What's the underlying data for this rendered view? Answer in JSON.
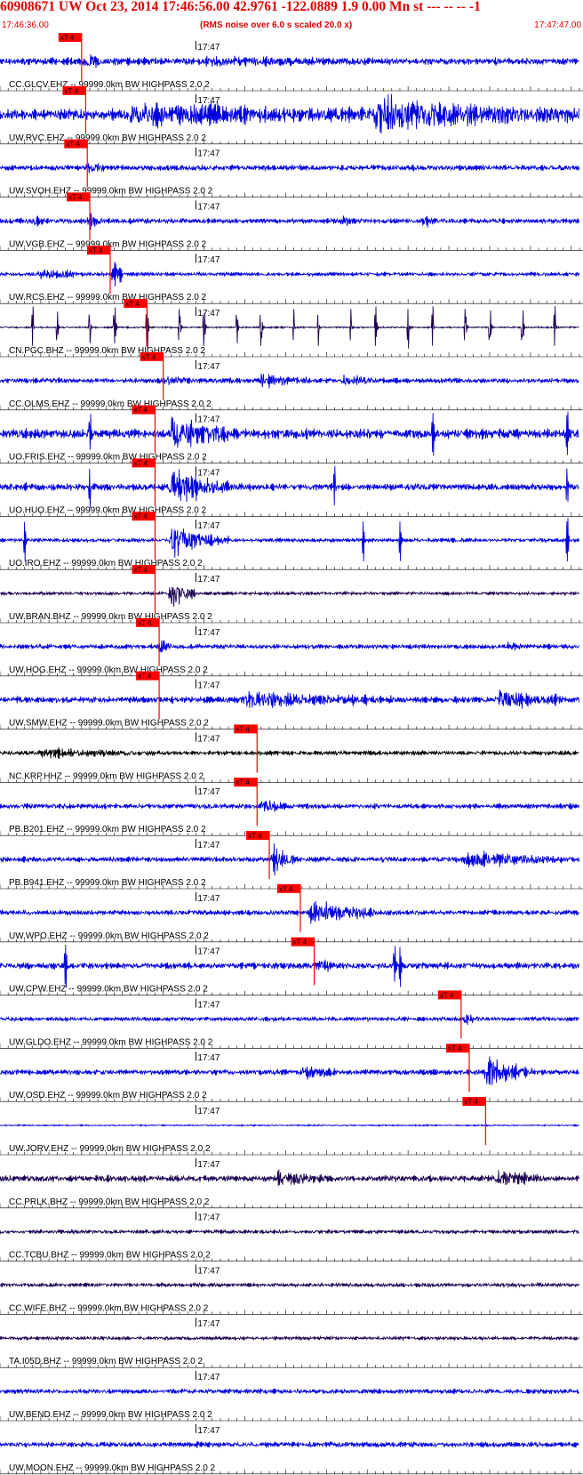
{
  "header": {
    "title": "60908671 UW Oct 23, 2014 17:46:56.00   42.9761 -122.0889  1.9 0.00 Mn st --- -- --  -1",
    "start_time": "17:46:36.00",
    "rms_note": "(RMS noise over 6.0 s scaled 20.0 x)",
    "end_time": "17:47:47.00"
  },
  "colors": {
    "header_text": "#e00000",
    "pick_box": "#ff0000",
    "pick_line": "#ff0000",
    "trace_blue": "#0000e0",
    "trace_dark": "#1a0050",
    "trace_black": "#000000"
  },
  "chart_data": {
    "type": "line",
    "title": "60908671 UW Oct 23, 2014 17:46:56.00   42.9761 -122.0889  1.9 0.00 Mn st --- -- --  -1",
    "x_start": "17:46:36.00",
    "x_end": "17:47:47.00",
    "x_range_seconds": [
      0,
      71
    ],
    "tick_label": "17:47",
    "tick_label_second": 24,
    "pick_label": "xT 4",
    "series": [
      {
        "name": "CC.GLCV.EHZ -- 99999.0km BW  HIGHPASS  2.0  2",
        "pick_second": 10.0,
        "color": "blue",
        "noise": 0.22,
        "bursts": [
          [
            10,
            4.5,
            0.35
          ],
          [
            25,
            20,
            0.15
          ]
        ],
        "spikes": []
      },
      {
        "name": "UW.RVC.EHZ -- 99999.0km BW  HIGHPASS  2.0  2",
        "pick_second": 10.5,
        "color": "blue",
        "noise": 0.35,
        "bursts": [
          [
            16,
            30,
            0.5
          ],
          [
            46,
            25,
            0.95
          ]
        ],
        "spikes": []
      },
      {
        "name": "UW.SVOH.EHZ -- 99999.0km BW  HIGHPASS  2.0  2",
        "pick_second": 10.7,
        "color": "blue",
        "noise": 0.18,
        "bursts": [
          [
            10.7,
            2,
            0.25
          ]
        ],
        "spikes": []
      },
      {
        "name": "UW.VGB.EHZ -- 99999.0km BW  HIGHPASS  2.0  2",
        "pick_second": 11.0,
        "color": "blue",
        "noise": 0.16,
        "bursts": [
          [
            4,
            1.5,
            0.3
          ],
          [
            11,
            1.5,
            0.45
          ],
          [
            42,
            1.5,
            0.35
          ],
          [
            52,
            1.5,
            0.35
          ]
        ],
        "spikes": []
      },
      {
        "name": "UW.RCS.EHZ -- 99999.0km BW  HIGHPASS  2.0  2",
        "pick_second": 13.5,
        "color": "blue",
        "noise": 0.12,
        "bursts": [
          [
            5,
            5,
            0.45
          ],
          [
            14,
            1.2,
            1.1
          ]
        ],
        "spikes": []
      },
      {
        "name": "CN.PGC.BHZ -- 99999.0km BW  HIGHPASS  2.0  2",
        "pick_second": 18.0,
        "color": "dark",
        "noise": 0.05,
        "bursts": [],
        "spikes": [
          4,
          7,
          11,
          14,
          18,
          22,
          25,
          29,
          32,
          36,
          39,
          43,
          46,
          50,
          53,
          57,
          60,
          64,
          68
        ]
      },
      {
        "name": "CC.OLMS.EHZ -- 99999.0km BW  HIGHPASS  2.0  2",
        "pick_second": 20.0,
        "color": "blue",
        "noise": 0.16,
        "bursts": [
          [
            20,
            3,
            0.3
          ],
          [
            32,
            6,
            0.4
          ],
          [
            42,
            4,
            0.35
          ]
        ],
        "spikes": []
      },
      {
        "name": "UO.FRIS.EHZ -- 99999.0km BW  HIGHPASS  2.0  2",
        "pick_second": 19.0,
        "color": "blue",
        "noise": 0.3,
        "bursts": [
          [
            21,
            7,
            1.15
          ]
        ],
        "spikes": [
          11,
          53,
          69.5
        ]
      },
      {
        "name": "UO.HUO.EHZ -- 99999.0km BW  HIGHPASS  2.0  2",
        "pick_second": 19.0,
        "color": "blue",
        "noise": 0.22,
        "bursts": [
          [
            21,
            7,
            1.15
          ]
        ],
        "spikes": [
          11,
          41,
          69.5
        ]
      },
      {
        "name": "UO.IRO.EHZ -- 99999.0km BW  HIGHPASS  2.0  2",
        "pick_second": 19.0,
        "color": "blue",
        "noise": 0.12,
        "bursts": [
          [
            21,
            7,
            1.05
          ]
        ],
        "spikes": [
          3,
          44.5,
          49,
          69.5
        ]
      },
      {
        "name": "UW.BRAN.BHZ -- 99999.0km BW  HIGHPASS  2.0  2",
        "pick_second": 19.0,
        "color": "dark",
        "noise": 0.1,
        "bursts": [
          [
            21,
            3,
            1.15
          ]
        ],
        "spikes": []
      },
      {
        "name": "UW.HOG.EHZ -- 99999.0km BW  HIGHPASS  2.0  2",
        "pick_second": 19.5,
        "color": "blue",
        "noise": 0.15,
        "bursts": [
          [
            19.5,
            1.5,
            0.55
          ],
          [
            62,
            2,
            0.3
          ]
        ],
        "spikes": []
      },
      {
        "name": "UW.SMW.EHZ -- 99999.0km BW  HIGHPASS  2.0  2",
        "pick_second": 19.5,
        "color": "blue",
        "noise": 0.2,
        "bursts": [
          [
            30,
            18,
            0.45
          ],
          [
            61,
            8,
            0.55
          ]
        ],
        "spikes": []
      },
      {
        "name": "NC.KRP.HHZ -- 99999.0km BW  HIGHPASS  2.0  2",
        "pick_second": 31.5,
        "color": "black",
        "noise": 0.14,
        "bursts": [
          [
            5,
            12,
            0.25
          ]
        ],
        "spikes": []
      },
      {
        "name": "PB.B201.EHZ -- 99999.0km BW  HIGHPASS  2.0  2",
        "pick_second": 31.5,
        "color": "blue",
        "noise": 0.16,
        "bursts": [
          [
            32,
            3,
            0.45
          ]
        ],
        "spikes": []
      },
      {
        "name": "PB.B941.EHZ -- 99999.0km BW  HIGHPASS  2.0  2",
        "pick_second": 33.0,
        "color": "blue",
        "noise": 0.17,
        "bursts": [
          [
            33.5,
            3,
            0.7
          ],
          [
            57,
            12,
            0.5
          ]
        ],
        "spikes": []
      },
      {
        "name": "UW.WPO.EHZ -- 99999.0km BW  HIGHPASS  2.0  2",
        "pick_second": 36.8,
        "color": "blue",
        "noise": 0.16,
        "bursts": [
          [
            38,
            8,
            0.8
          ]
        ],
        "spikes": []
      },
      {
        "name": "UW.CPW.EHZ -- 99999.0km BW  HIGHPASS  2.0  2",
        "pick_second": 38.5,
        "color": "blue",
        "noise": 0.2,
        "bursts": [
          [
            39,
            2,
            0.4
          ]
        ],
        "spikes": [
          8,
          49,
          48.3
        ]
      },
      {
        "name": "UW.GLDO.EHZ -- 99999.0km BW  HIGHPASS  2.0  2",
        "pick_second": 56.5,
        "color": "blue",
        "noise": 0.13,
        "bursts": [
          [
            57,
            2,
            0.35
          ]
        ],
        "spikes": []
      },
      {
        "name": "UW.OSD.EHZ -- 99999.0km BW  HIGHPASS  2.0  2",
        "pick_second": 57.5,
        "color": "blue",
        "noise": 0.17,
        "bursts": [
          [
            37,
            4,
            0.45
          ],
          [
            59.5,
            6,
            0.95
          ]
        ],
        "spikes": []
      },
      {
        "name": "UW.JORV.EHZ -- 99999.0km BW  HIGHPASS  2.0  2",
        "pick_second": 59.5,
        "color": "blue",
        "noise": 0.04,
        "bursts": [],
        "spikes": []
      },
      {
        "name": "CC.PRLK.BHZ -- 99999.0km BW  HIGHPASS  2.0  2",
        "pick_second": null,
        "color": "dark",
        "noise": 0.2,
        "bursts": [
          [
            34,
            6,
            0.45
          ],
          [
            61,
            5,
            0.4
          ]
        ],
        "spikes": []
      },
      {
        "name": "CC.TCBU.BHZ -- 99999.0km BW  HIGHPASS  2.0  2",
        "pick_second": null,
        "color": "dark",
        "noise": 0.12,
        "bursts": [],
        "spikes": []
      },
      {
        "name": "CC.WIFE.BHZ -- 99999.0km BW  HIGHPASS  2.0  2",
        "pick_second": null,
        "color": "dark",
        "noise": 0.12,
        "bursts": [],
        "spikes": []
      },
      {
        "name": "TA.I05D.BHZ -- 99999.0km BW  HIGHPASS  2.0  2",
        "pick_second": null,
        "color": "dark",
        "noise": 0.11,
        "bursts": [],
        "spikes": []
      },
      {
        "name": "UW.BEND.EHZ -- 99999.0km BW  HIGHPASS  2.0  2",
        "pick_second": null,
        "color": "blue",
        "noise": 0.15,
        "bursts": [],
        "spikes": []
      },
      {
        "name": "UW.MOON.EHZ -- 99999.0km BW  HIGHPASS  2.0  2",
        "pick_second": null,
        "color": "blue",
        "noise": 0.17,
        "bursts": [],
        "spikes": []
      }
    ]
  }
}
